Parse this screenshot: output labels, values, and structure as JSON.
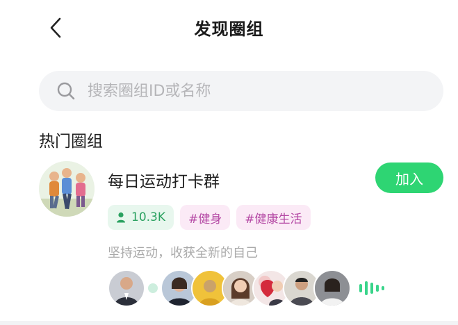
{
  "header": {
    "title": "发现圈组",
    "back_icon": "chevron-left-icon"
  },
  "search": {
    "placeholder": "搜索圈组ID或名称",
    "value": "",
    "icon": "search-icon"
  },
  "section": {
    "title": "热门圈组"
  },
  "group": {
    "name": "每日运动打卡群",
    "join_label": "加入",
    "member_count": "10.3K",
    "tags": [
      "#健身",
      "#健康生活"
    ],
    "description": "坚持运动，收获全新的自己"
  },
  "colors": {
    "accent": "#2ed573",
    "member_tag_bg": "#e8f7ee",
    "member_tag_text": "#2aa160",
    "topic_tag_bg": "#fbeaf6",
    "topic_tag_text": "#b54aa5"
  }
}
